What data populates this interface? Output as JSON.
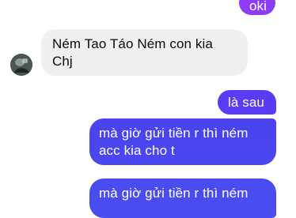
{
  "messages": [
    {
      "direction": "outgoing",
      "text": "oki"
    },
    {
      "direction": "incoming",
      "line1": "Ném Tao Táo Ném con kia",
      "line2": "Chj"
    },
    {
      "direction": "outgoing",
      "text": "là sau"
    },
    {
      "direction": "outgoing",
      "line1": "mà giờ gửi tiền r thì ném",
      "line2": "acc kia cho t"
    },
    {
      "direction": "outgoing",
      "text": "mà giờ gửi tiền r thì ném"
    }
  ],
  "colors": {
    "incoming_bubble": "#f1f0f0",
    "outgoing_purple": "#8f3dfa",
    "outgoing_blue": "#4a46f0",
    "text_dark": "#0a0a0a",
    "text_light": "#ffffff"
  },
  "contact": {
    "avatar_icon": "profile-avatar"
  }
}
